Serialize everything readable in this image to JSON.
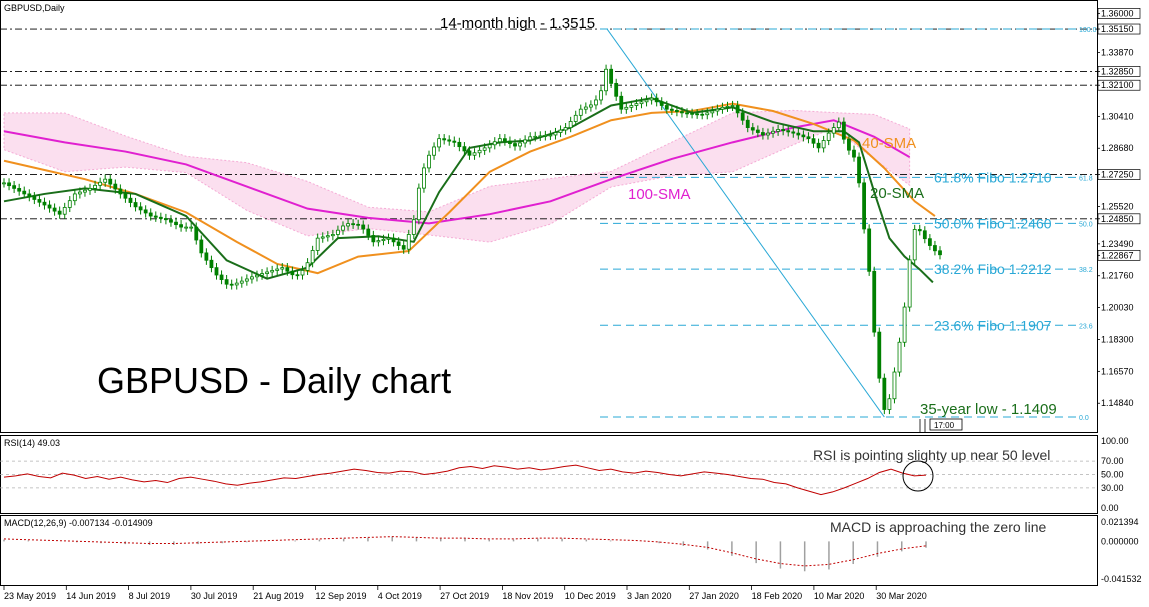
{
  "chart_title": "GBPUSD - Daily chart",
  "symbol_label": "GBPUSD,Daily",
  "annotations": {
    "high": "14-month high - 1.3515",
    "low": "35-year low - 1.1409",
    "sma40": "40-SMA",
    "sma20": "20-SMA",
    "sma100": "100-SMA",
    "rsi_note": "RSI is pointing slighty up near 50 level",
    "macd_note": "MACD is approaching the zero line",
    "time_box": "17:00"
  },
  "colors": {
    "candle": "#008000",
    "sma20": "#1a6e1a",
    "sma40": "#f0901e",
    "sma100": "#e020d0",
    "ichimoku_cloud": "#f080c0",
    "tenkan": "#d01010",
    "kijun": "#1010c0",
    "chikou": "#40d040",
    "fibo": "#29a8d6",
    "rsi": "#c00000",
    "macd": "#a0a0a0"
  },
  "chart_data": [
    {
      "type": "candlestick",
      "title": "GBPUSD - Daily chart",
      "ylim": [
        1.1355,
        1.364
      ],
      "y_ticks": [
        "1.36000",
        "1.35150",
        "1.33870",
        "1.32850",
        "1.32100",
        "1.30410",
        "1.28680",
        "1.27250",
        "1.25520",
        "1.24850",
        "1.23490",
        "1.22867",
        "1.21760",
        "1.20030",
        "1.18300",
        "1.16570",
        "1.14840"
      ],
      "x_ticks": [
        "23 May 2019",
        "14 Jun 2019",
        "8 Jul 2019",
        "30 Jul 2019",
        "21 Aug 2019",
        "12 Sep 2019",
        "4 Oct 2019",
        "27 Oct 2019",
        "18 Nov 2019",
        "10 Dec 2019",
        "3 Jan 2020",
        "27 Jan 2020",
        "18 Feb 2020",
        "10 Mar 2020",
        "30 Mar 2020"
      ],
      "close_path": [
        [
          0,
          1.268
        ],
        [
          20,
          1.262
        ],
        [
          40,
          1.256
        ],
        [
          55,
          1.251
        ],
        [
          70,
          1.262
        ],
        [
          85,
          1.265
        ],
        [
          100,
          1.27
        ],
        [
          115,
          1.262
        ],
        [
          130,
          1.255
        ],
        [
          145,
          1.25
        ],
        [
          160,
          1.248
        ],
        [
          175,
          1.244
        ],
        [
          185,
          1.244
        ],
        [
          195,
          1.23
        ],
        [
          210,
          1.218
        ],
        [
          222,
          1.212
        ],
        [
          232,
          1.214
        ],
        [
          245,
          1.217
        ],
        [
          262,
          1.22
        ],
        [
          275,
          1.222
        ],
        [
          288,
          1.217
        ],
        [
          298,
          1.222
        ],
        [
          310,
          1.238
        ],
        [
          325,
          1.24
        ],
        [
          338,
          1.246
        ],
        [
          352,
          1.245
        ],
        [
          365,
          1.236
        ],
        [
          380,
          1.238
        ],
        [
          395,
          1.232
        ],
        [
          405,
          1.248
        ],
        [
          412,
          1.272
        ],
        [
          420,
          1.283
        ],
        [
          430,
          1.292
        ],
        [
          445,
          1.29
        ],
        [
          460,
          1.283
        ],
        [
          475,
          1.287
        ],
        [
          490,
          1.292
        ],
        [
          505,
          1.288
        ],
        [
          520,
          1.293
        ],
        [
          540,
          1.294
        ],
        [
          555,
          1.298
        ],
        [
          570,
          1.308
        ],
        [
          583,
          1.311
        ],
        [
          590,
          1.318
        ],
        [
          596,
          1.332
        ],
        [
          600,
          1.322
        ],
        [
          610,
          1.308
        ],
        [
          625,
          1.311
        ],
        [
          640,
          1.314
        ],
        [
          655,
          1.308
        ],
        [
          670,
          1.306
        ],
        [
          690,
          1.305
        ],
        [
          710,
          1.309
        ],
        [
          720,
          1.31
        ],
        [
          735,
          1.298
        ],
        [
          750,
          1.294
        ],
        [
          765,
          1.297
        ],
        [
          780,
          1.295
        ],
        [
          795,
          1.292
        ],
        [
          805,
          1.287
        ],
        [
          815,
          1.295
        ],
        [
          825,
          1.301
        ],
        [
          832,
          1.288
        ],
        [
          840,
          1.282
        ],
        [
          845,
          1.268
        ],
        [
          850,
          1.243
        ],
        [
          855,
          1.22
        ],
        [
          860,
          1.187
        ],
        [
          865,
          1.162
        ],
        [
          870,
          1.145
        ],
        [
          876,
          1.152
        ],
        [
          882,
          1.172
        ],
        [
          888,
          1.191
        ],
        [
          893,
          1.215
        ],
        [
          898,
          1.243
        ],
        [
          905,
          1.242
        ],
        [
          912,
          1.236
        ],
        [
          918,
          1.232
        ],
        [
          925,
          1.229
        ]
      ],
      "sma20": [
        [
          0,
          1.258
        ],
        [
          40,
          1.262
        ],
        [
          80,
          1.265
        ],
        [
          130,
          1.262
        ],
        [
          180,
          1.25
        ],
        [
          220,
          1.226
        ],
        [
          260,
          1.216
        ],
        [
          300,
          1.222
        ],
        [
          330,
          1.238
        ],
        [
          370,
          1.239
        ],
        [
          405,
          1.236
        ],
        [
          430,
          1.263
        ],
        [
          460,
          1.287
        ],
        [
          490,
          1.29
        ],
        [
          520,
          1.291
        ],
        [
          560,
          1.298
        ],
        [
          600,
          1.31
        ],
        [
          640,
          1.314
        ],
        [
          680,
          1.306
        ],
        [
          720,
          1.309
        ],
        [
          760,
          1.301
        ],
        [
          800,
          1.296
        ],
        [
          830,
          1.296
        ],
        [
          845,
          1.29
        ],
        [
          860,
          1.263
        ],
        [
          875,
          1.238
        ],
        [
          890,
          1.228
        ],
        [
          905,
          1.221
        ],
        [
          918,
          1.214
        ]
      ],
      "sma40": [
        [
          0,
          1.28
        ],
        [
          40,
          1.275
        ],
        [
          80,
          1.27
        ],
        [
          130,
          1.262
        ],
        [
          180,
          1.252
        ],
        [
          230,
          1.236
        ],
        [
          270,
          1.224
        ],
        [
          310,
          1.219
        ],
        [
          350,
          1.228
        ],
        [
          400,
          1.231
        ],
        [
          440,
          1.252
        ],
        [
          480,
          1.274
        ],
        [
          520,
          1.285
        ],
        [
          560,
          1.293
        ],
        [
          600,
          1.302
        ],
        [
          640,
          1.306
        ],
        [
          680,
          1.307
        ],
        [
          720,
          1.311
        ],
        [
          760,
          1.307
        ],
        [
          800,
          1.3
        ],
        [
          840,
          1.291
        ],
        [
          870,
          1.276
        ],
        [
          900,
          1.258
        ],
        [
          920,
          1.25
        ]
      ],
      "sma100": [
        [
          0,
          1.296
        ],
        [
          60,
          1.29
        ],
        [
          120,
          1.285
        ],
        [
          180,
          1.278
        ],
        [
          240,
          1.266
        ],
        [
          300,
          1.254
        ],
        [
          360,
          1.249
        ],
        [
          420,
          1.246
        ],
        [
          480,
          1.251
        ],
        [
          540,
          1.258
        ],
        [
          600,
          1.27
        ],
        [
          660,
          1.281
        ],
        [
          720,
          1.29
        ],
        [
          780,
          1.298
        ],
        [
          820,
          1.302
        ],
        [
          860,
          1.293
        ],
        [
          895,
          1.282
        ]
      ],
      "fibonacci": [
        {
          "level": "100.0",
          "price": 1.3515,
          "label": ""
        },
        {
          "level": "61.8",
          "price": 1.271,
          "label": "61.8% Fibo 1.2710"
        },
        {
          "level": "50.0",
          "price": 1.246,
          "label": "50.0% Fibo 1.2460"
        },
        {
          "level": "38.2",
          "price": 1.2212,
          "label": "38.2% Fibo 1.2212"
        },
        {
          "level": "23.6",
          "price": 1.1907,
          "label": "23.6% Fibo 1.1907"
        },
        {
          "level": "0.0",
          "price": 1.1409,
          "label": ""
        }
      ],
      "horizontal_levels": [
        1.3515,
        1.3285,
        1.321,
        1.2725,
        1.2485
      ],
      "last_price": 1.22867
    },
    {
      "type": "line",
      "title": "RSI(14) 49.03",
      "ylim": [
        0,
        100
      ],
      "y_ticks": [
        "100.00",
        "70.00",
        "50.00",
        "30.00",
        "0.00"
      ],
      "values": [
        46,
        48,
        51,
        47,
        45,
        52,
        49,
        44,
        47,
        43,
        46,
        42,
        39,
        41,
        38,
        44,
        46,
        43,
        40,
        36,
        34,
        37,
        39,
        42,
        45,
        44,
        47,
        50,
        52,
        55,
        58,
        56,
        53,
        52,
        55,
        54,
        50,
        52,
        55,
        60,
        62,
        59,
        63,
        61,
        58,
        60,
        57,
        59,
        62,
        64,
        60,
        56,
        58,
        54,
        52,
        55,
        53,
        50,
        48,
        51,
        54,
        52,
        50,
        47,
        44,
        43,
        38,
        36,
        30,
        25,
        20,
        24,
        30,
        37,
        44,
        53,
        58,
        52,
        48,
        49
      ]
    },
    {
      "type": "line",
      "title": "MACD(12,26,9) -0.007134 -0.014909",
      "ylim": [
        -0.041532,
        0.021394
      ],
      "y_ticks": [
        "0.021394",
        "0.000000",
        "-0.041532"
      ],
      "values": [
        0.002,
        0.001,
        0.0,
        -0.001,
        -0.002,
        -0.003,
        -0.004,
        -0.004,
        -0.003,
        -0.002,
        -0.001,
        0.0,
        0.001,
        0.002,
        0.003,
        0.004,
        0.005,
        0.004,
        0.003,
        0.003,
        0.002,
        0.002,
        0.003,
        0.003,
        0.002,
        0.001,
        0.0,
        -0.002,
        -0.005,
        -0.009,
        -0.016,
        -0.024,
        -0.03,
        -0.033,
        -0.031,
        -0.025,
        -0.017,
        -0.011,
        -0.007
      ]
    }
  ]
}
